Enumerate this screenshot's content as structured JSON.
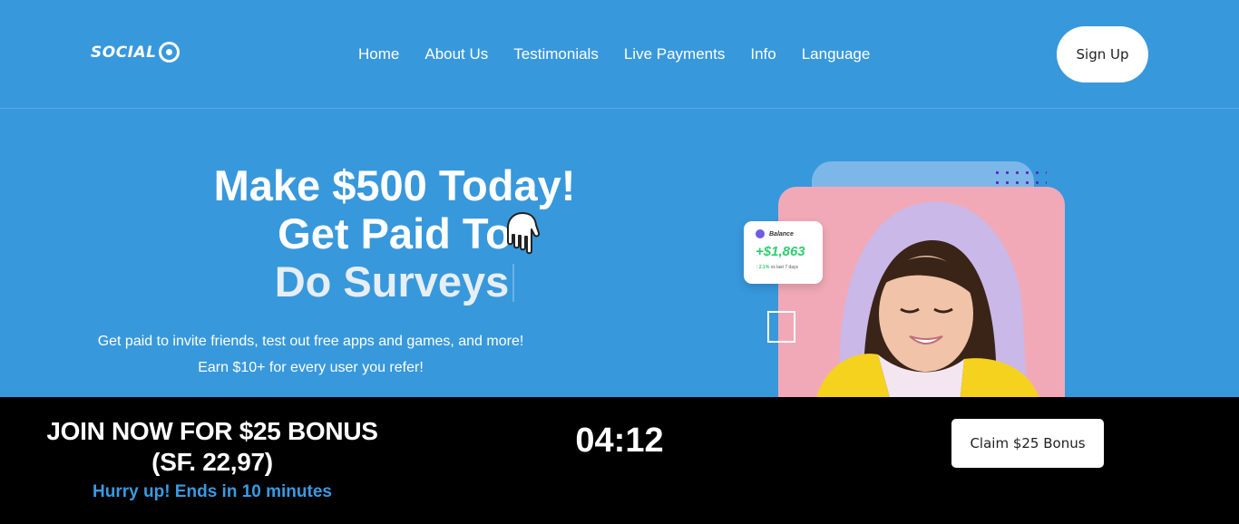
{
  "brand": {
    "logo_text": "SOCIAL"
  },
  "nav": {
    "items": [
      {
        "label": "Home"
      },
      {
        "label": "About Us"
      },
      {
        "label": "Testimonials"
      },
      {
        "label": "Live Payments"
      },
      {
        "label": "Info"
      },
      {
        "label": "Language"
      }
    ]
  },
  "header": {
    "signup_label": "Sign Up"
  },
  "hero": {
    "line1": "Make $500 Today!",
    "line2": "Get Paid To",
    "line3": "Do Surveys",
    "subtext": "Get paid to invite friends, test out free apps and games, and more! Earn $10+ for every user you refer!",
    "pointing_hand_icon": "pointing-down-hand-icon"
  },
  "balance_card": {
    "title": "Balance",
    "amount": "+$1,863",
    "change": "2.1%",
    "note": "vs last 7 days"
  },
  "promo_bar": {
    "headline_1": "JOIN NOW FOR $25 BONUS",
    "headline_2": "(SF. 22,97)",
    "subtext": "Hurry up! Ends in 10 minutes",
    "timer": "04:12",
    "claim_label": "Claim $25 Bonus"
  },
  "colors": {
    "background": "#3898dc",
    "bar_background": "#000000",
    "accent_text": "#3a9ae0",
    "positive": "#2ecc71",
    "art_pink": "#f2a9b7",
    "art_blue": "#7db7e9"
  }
}
